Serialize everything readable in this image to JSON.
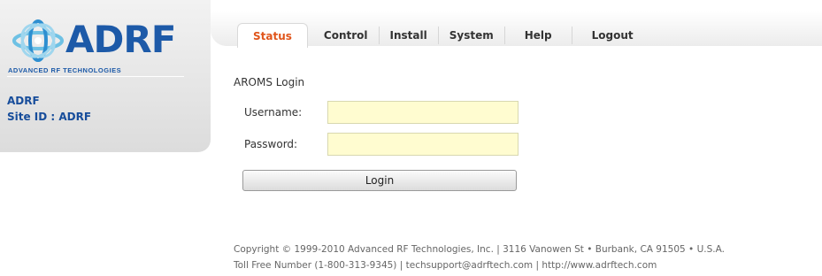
{
  "brand": {
    "logo_text": "ADRF",
    "logo_subtitle": "ADVANCED RF TECHNOLOGIES",
    "brand_color": "#1d5aa8"
  },
  "site": {
    "name": "ADRF",
    "id_label": "Site ID : ADRF"
  },
  "nav": {
    "tabs": [
      {
        "label": "Status",
        "active": true
      },
      {
        "label": "Control",
        "active": false
      },
      {
        "label": "Install",
        "active": false
      },
      {
        "label": "System",
        "active": false
      },
      {
        "label": "Help",
        "active": false
      },
      {
        "label": "Logout",
        "active": false
      }
    ],
    "active_color": "#e0551b"
  },
  "login": {
    "title": "AROMS Login",
    "username_label": "Username:",
    "username_value": "",
    "password_label": "Password:",
    "password_value": "",
    "button_label": "Login"
  },
  "footer": {
    "line1": "Copyright © 1999-2010 Advanced RF Technologies, Inc. | 3116 Vanowen St • Burbank, CA 91505 • U.S.A.",
    "line2": "Toll Free Number (1-800-313-9345) | techsupport@adrftech.com | http://www.adrftech.com"
  }
}
